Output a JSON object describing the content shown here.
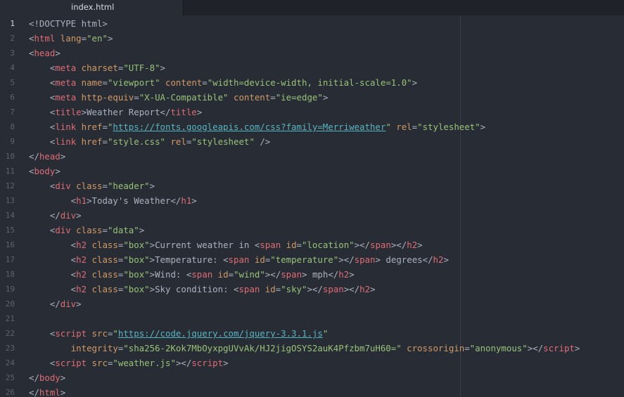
{
  "tab": {
    "label": "index.html"
  },
  "colors": {
    "background": "#282c34",
    "tag": "#e06c75",
    "attribute": "#d19a66",
    "string": "#98c379",
    "link": "#56b6c2",
    "text": "#abb2bf",
    "gutter": "#5c6370"
  },
  "lines": [
    {
      "n": "1",
      "tokens": [
        [
          "pun",
          "<!DOCTYPE html>"
        ]
      ]
    },
    {
      "n": "2",
      "tokens": [
        [
          "pun",
          "<"
        ],
        [
          "tag",
          "html"
        ],
        [
          "pun",
          " "
        ],
        [
          "attr",
          "lang"
        ],
        [
          "pun",
          "="
        ],
        [
          "str",
          "\"en\""
        ],
        [
          "pun",
          ">"
        ]
      ]
    },
    {
      "n": "3",
      "tokens": [
        [
          "pun",
          "<"
        ],
        [
          "tag",
          "head"
        ],
        [
          "pun",
          ">"
        ]
      ]
    },
    {
      "n": "4",
      "tokens": [
        [
          "pun",
          "    <"
        ],
        [
          "tag",
          "meta"
        ],
        [
          "pun",
          " "
        ],
        [
          "attr",
          "charset"
        ],
        [
          "pun",
          "="
        ],
        [
          "str",
          "\"UTF-8\""
        ],
        [
          "pun",
          ">"
        ]
      ]
    },
    {
      "n": "5",
      "tokens": [
        [
          "pun",
          "    <"
        ],
        [
          "tag",
          "meta"
        ],
        [
          "pun",
          " "
        ],
        [
          "attr",
          "name"
        ],
        [
          "pun",
          "="
        ],
        [
          "str",
          "\"viewport\""
        ],
        [
          "pun",
          " "
        ],
        [
          "attr",
          "content"
        ],
        [
          "pun",
          "="
        ],
        [
          "str",
          "\"width=device-width, initial-scale=1.0\""
        ],
        [
          "pun",
          ">"
        ]
      ]
    },
    {
      "n": "6",
      "tokens": [
        [
          "pun",
          "    <"
        ],
        [
          "tag",
          "meta"
        ],
        [
          "pun",
          " "
        ],
        [
          "attr",
          "http-equiv"
        ],
        [
          "pun",
          "="
        ],
        [
          "str",
          "\"X-UA-Compatible\""
        ],
        [
          "pun",
          " "
        ],
        [
          "attr",
          "content"
        ],
        [
          "pun",
          "="
        ],
        [
          "str",
          "\"ie=edge\""
        ],
        [
          "pun",
          ">"
        ]
      ]
    },
    {
      "n": "7",
      "tokens": [
        [
          "pun",
          "    <"
        ],
        [
          "tag",
          "title"
        ],
        [
          "pun",
          ">"
        ],
        [
          "txt",
          "Weather Report"
        ],
        [
          "pun",
          "</"
        ],
        [
          "tag",
          "title"
        ],
        [
          "pun",
          ">"
        ]
      ]
    },
    {
      "n": "8",
      "tokens": [
        [
          "pun",
          "    <"
        ],
        [
          "tag",
          "link"
        ],
        [
          "pun",
          " "
        ],
        [
          "attr",
          "href"
        ],
        [
          "pun",
          "="
        ],
        [
          "str",
          "\""
        ],
        [
          "link",
          "https://fonts.googleapis.com/css?family=Merriweather"
        ],
        [
          "str",
          "\""
        ],
        [
          "pun",
          " "
        ],
        [
          "attr",
          "rel"
        ],
        [
          "pun",
          "="
        ],
        [
          "str",
          "\"stylesheet\""
        ],
        [
          "pun",
          ">"
        ]
      ]
    },
    {
      "n": "9",
      "tokens": [
        [
          "pun",
          "    <"
        ],
        [
          "tag",
          "link"
        ],
        [
          "pun",
          " "
        ],
        [
          "attr",
          "href"
        ],
        [
          "pun",
          "="
        ],
        [
          "str",
          "\"style.css\""
        ],
        [
          "pun",
          " "
        ],
        [
          "attr",
          "rel"
        ],
        [
          "pun",
          "="
        ],
        [
          "str",
          "\"stylesheet\""
        ],
        [
          "pun",
          " />"
        ]
      ]
    },
    {
      "n": "10",
      "tokens": [
        [
          "pun",
          "</"
        ],
        [
          "tag",
          "head"
        ],
        [
          "pun",
          ">"
        ]
      ]
    },
    {
      "n": "11",
      "tokens": [
        [
          "pun",
          "<"
        ],
        [
          "tag",
          "body"
        ],
        [
          "pun",
          ">"
        ]
      ]
    },
    {
      "n": "12",
      "tokens": [
        [
          "pun",
          "    <"
        ],
        [
          "tag",
          "div"
        ],
        [
          "pun",
          " "
        ],
        [
          "attr",
          "class"
        ],
        [
          "pun",
          "="
        ],
        [
          "str",
          "\"header\""
        ],
        [
          "pun",
          ">"
        ]
      ]
    },
    {
      "n": "13",
      "tokens": [
        [
          "pun",
          "        <"
        ],
        [
          "tag",
          "h1"
        ],
        [
          "pun",
          ">"
        ],
        [
          "txt",
          "Today's Weather"
        ],
        [
          "pun",
          "</"
        ],
        [
          "tag",
          "h1"
        ],
        [
          "pun",
          ">"
        ]
      ]
    },
    {
      "n": "14",
      "tokens": [
        [
          "pun",
          "    </"
        ],
        [
          "tag",
          "div"
        ],
        [
          "pun",
          ">"
        ]
      ]
    },
    {
      "n": "15",
      "tokens": [
        [
          "pun",
          "    <"
        ],
        [
          "tag",
          "div"
        ],
        [
          "pun",
          " "
        ],
        [
          "attr",
          "class"
        ],
        [
          "pun",
          "="
        ],
        [
          "str",
          "\"data\""
        ],
        [
          "pun",
          ">"
        ]
      ]
    },
    {
      "n": "16",
      "tokens": [
        [
          "pun",
          "        <"
        ],
        [
          "tag",
          "h2"
        ],
        [
          "pun",
          " "
        ],
        [
          "attr",
          "class"
        ],
        [
          "pun",
          "="
        ],
        [
          "str",
          "\"box\""
        ],
        [
          "pun",
          ">"
        ],
        [
          "txt",
          "Current weather in "
        ],
        [
          "pun",
          "<"
        ],
        [
          "tag",
          "span"
        ],
        [
          "pun",
          " "
        ],
        [
          "attr",
          "id"
        ],
        [
          "pun",
          "="
        ],
        [
          "str",
          "\"location\""
        ],
        [
          "pun",
          "></"
        ],
        [
          "tag",
          "span"
        ],
        [
          "pun",
          "></"
        ],
        [
          "tag",
          "h2"
        ],
        [
          "pun",
          ">"
        ]
      ]
    },
    {
      "n": "17",
      "tokens": [
        [
          "pun",
          "        <"
        ],
        [
          "tag",
          "h2"
        ],
        [
          "pun",
          " "
        ],
        [
          "attr",
          "class"
        ],
        [
          "pun",
          "="
        ],
        [
          "str",
          "\"box\""
        ],
        [
          "pun",
          ">"
        ],
        [
          "txt",
          "Temperature: "
        ],
        [
          "pun",
          "<"
        ],
        [
          "tag",
          "span"
        ],
        [
          "pun",
          " "
        ],
        [
          "attr",
          "id"
        ],
        [
          "pun",
          "="
        ],
        [
          "str",
          "\"temperature\""
        ],
        [
          "pun",
          "></"
        ],
        [
          "tag",
          "span"
        ],
        [
          "pun",
          ">"
        ],
        [
          "txt",
          " degrees"
        ],
        [
          "pun",
          "</"
        ],
        [
          "tag",
          "h2"
        ],
        [
          "pun",
          ">"
        ]
      ]
    },
    {
      "n": "18",
      "tokens": [
        [
          "pun",
          "        <"
        ],
        [
          "tag",
          "h2"
        ],
        [
          "pun",
          " "
        ],
        [
          "attr",
          "class"
        ],
        [
          "pun",
          "="
        ],
        [
          "str",
          "\"box\""
        ],
        [
          "pun",
          ">"
        ],
        [
          "txt",
          "Wind: "
        ],
        [
          "pun",
          "<"
        ],
        [
          "tag",
          "span"
        ],
        [
          "pun",
          " "
        ],
        [
          "attr",
          "id"
        ],
        [
          "pun",
          "="
        ],
        [
          "str",
          "\"wind\""
        ],
        [
          "pun",
          "></"
        ],
        [
          "tag",
          "span"
        ],
        [
          "pun",
          ">"
        ],
        [
          "txt",
          " mph"
        ],
        [
          "pun",
          "</"
        ],
        [
          "tag",
          "h2"
        ],
        [
          "pun",
          ">"
        ]
      ]
    },
    {
      "n": "19",
      "tokens": [
        [
          "pun",
          "        <"
        ],
        [
          "tag",
          "h2"
        ],
        [
          "pun",
          " "
        ],
        [
          "attr",
          "class"
        ],
        [
          "pun",
          "="
        ],
        [
          "str",
          "\"box\""
        ],
        [
          "pun",
          ">"
        ],
        [
          "txt",
          "Sky condition: "
        ],
        [
          "pun",
          "<"
        ],
        [
          "tag",
          "span"
        ],
        [
          "pun",
          " "
        ],
        [
          "attr",
          "id"
        ],
        [
          "pun",
          "="
        ],
        [
          "str",
          "\"sky\""
        ],
        [
          "pun",
          "></"
        ],
        [
          "tag",
          "span"
        ],
        [
          "pun",
          "></"
        ],
        [
          "tag",
          "h2"
        ],
        [
          "pun",
          ">"
        ]
      ]
    },
    {
      "n": "20",
      "tokens": [
        [
          "pun",
          "    </"
        ],
        [
          "tag",
          "div"
        ],
        [
          "pun",
          ">"
        ]
      ]
    },
    {
      "n": "21",
      "tokens": []
    },
    {
      "n": "22",
      "tokens": [
        [
          "pun",
          "    <"
        ],
        [
          "tag",
          "script"
        ],
        [
          "pun",
          " "
        ],
        [
          "attr",
          "src"
        ],
        [
          "pun",
          "="
        ],
        [
          "str",
          "\""
        ],
        [
          "link",
          "https://code.jquery.com/jquery-3.3.1.js"
        ],
        [
          "str",
          "\""
        ]
      ]
    },
    {
      "n": "23",
      "tokens": [
        [
          "pun",
          "        "
        ],
        [
          "attr",
          "integrity"
        ],
        [
          "pun",
          "="
        ],
        [
          "str",
          "\"sha256-2Kok7MbOyxpgUVvAk/HJ2jigOSYS2auK4Pfzbm7uH60=\""
        ],
        [
          "pun",
          " "
        ],
        [
          "attr",
          "crossorigin"
        ],
        [
          "pun",
          "="
        ],
        [
          "str",
          "\"anonymous\""
        ],
        [
          "pun",
          "></"
        ],
        [
          "tag",
          "script"
        ],
        [
          "pun",
          ">"
        ]
      ]
    },
    {
      "n": "24",
      "tokens": [
        [
          "pun",
          "    <"
        ],
        [
          "tag",
          "script"
        ],
        [
          "pun",
          " "
        ],
        [
          "attr",
          "src"
        ],
        [
          "pun",
          "="
        ],
        [
          "str",
          "\"weather.js\""
        ],
        [
          "pun",
          "></"
        ],
        [
          "tag",
          "script"
        ],
        [
          "pun",
          ">"
        ]
      ]
    },
    {
      "n": "25",
      "tokens": [
        [
          "pun",
          "</"
        ],
        [
          "tag",
          "body"
        ],
        [
          "pun",
          ">"
        ]
      ]
    },
    {
      "n": "26",
      "tokens": [
        [
          "pun",
          "</"
        ],
        [
          "tag",
          "html"
        ],
        [
          "pun",
          ">"
        ]
      ]
    }
  ]
}
